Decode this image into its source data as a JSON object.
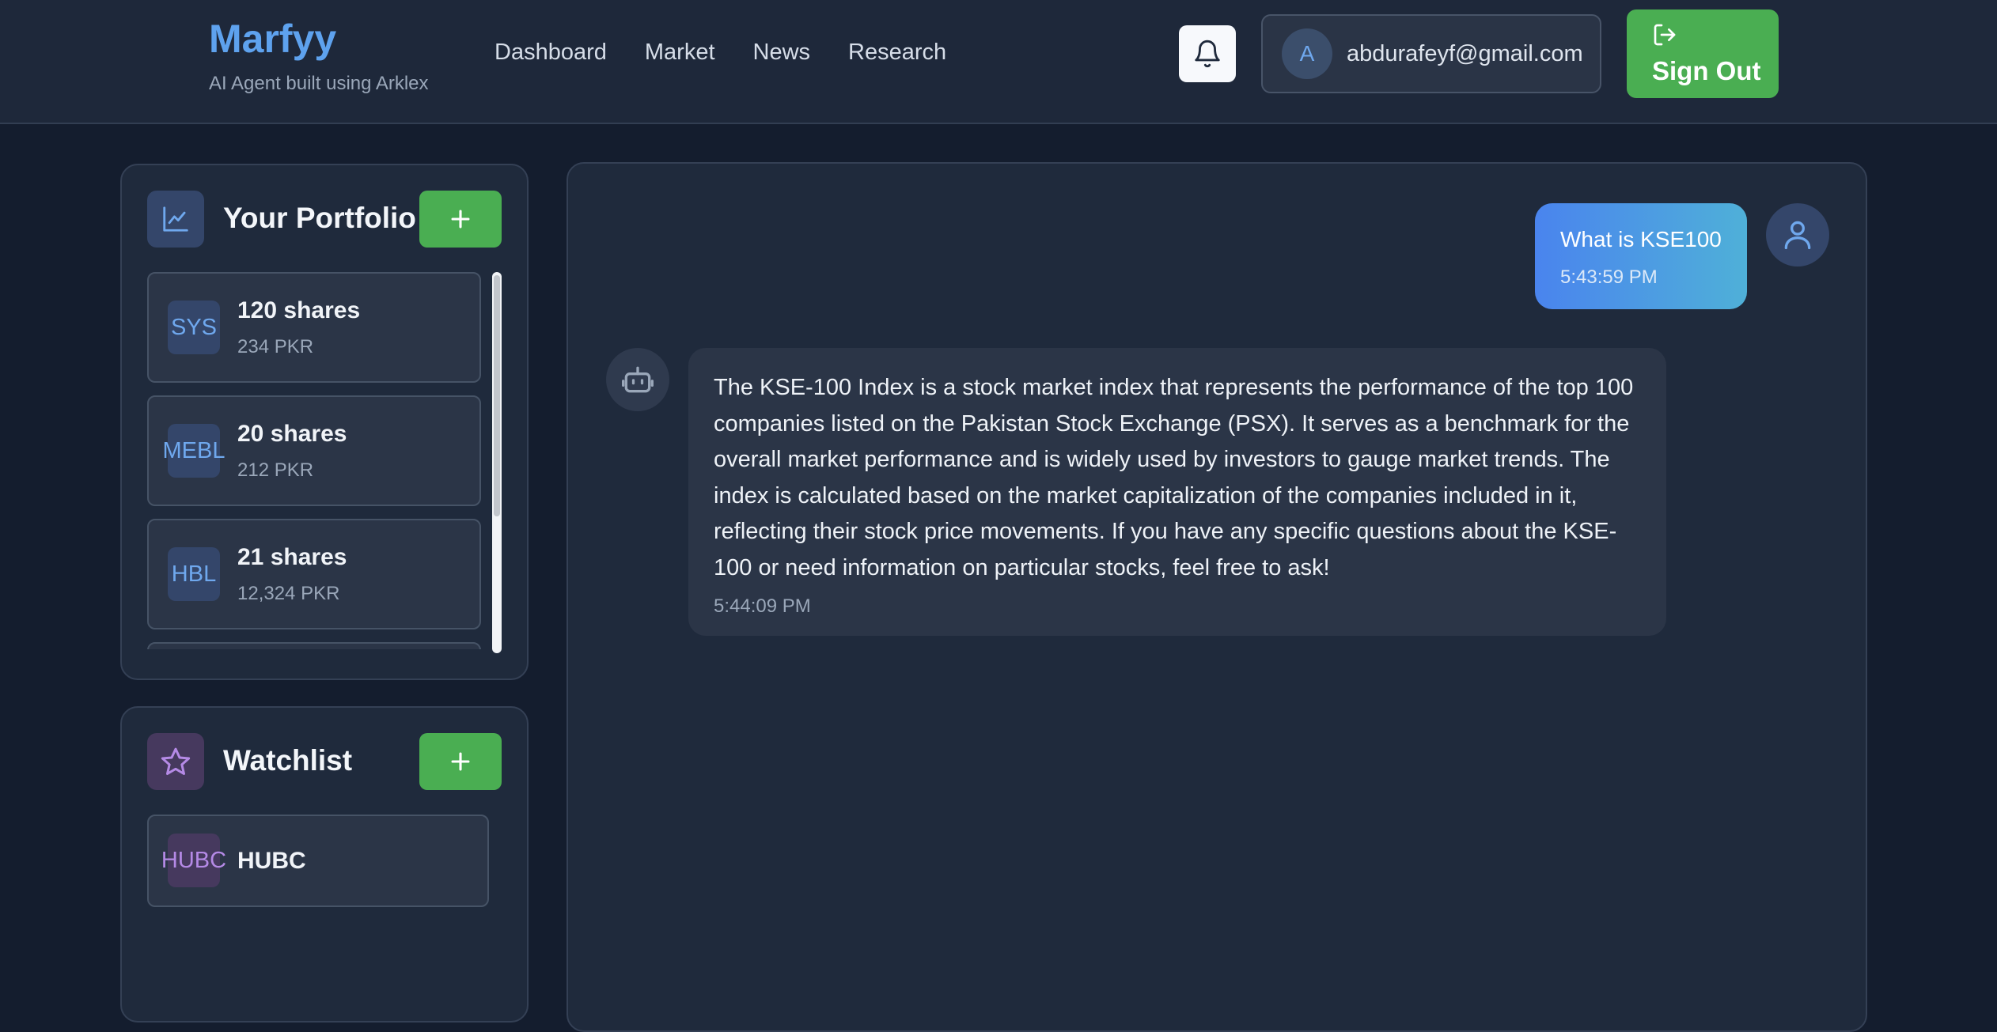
{
  "brand": {
    "title": "Marfyy",
    "subtitle": "AI Agent built using Arklex"
  },
  "nav": {
    "items": [
      "Dashboard",
      "Market",
      "News",
      "Research"
    ]
  },
  "user": {
    "initial": "A",
    "email": "abdurafeyf@gmail.com"
  },
  "header": {
    "signout_label": "Sign Out",
    "bell_icon": "bell-icon",
    "signout_icon": "log-out-icon"
  },
  "portfolio": {
    "title": "Your Portfolio",
    "icon": "chart-line-icon",
    "add_icon": "plus-icon",
    "holdings": [
      {
        "ticker": "SYS",
        "shares": "120 shares",
        "value": "234 PKR"
      },
      {
        "ticker": "MEBL",
        "shares": "20 shares",
        "value": "212 PKR"
      },
      {
        "ticker": "HBL",
        "shares": "21 shares",
        "value": "12,324 PKR"
      }
    ]
  },
  "watchlist": {
    "title": "Watchlist",
    "icon": "star-icon",
    "add_icon": "plus-icon",
    "items": [
      {
        "ticker": "HUBC",
        "name": "HUBC"
      }
    ]
  },
  "chat": {
    "messages": [
      {
        "role": "user",
        "text": "What is KSE100",
        "time": "5:43:59 PM"
      },
      {
        "role": "bot",
        "text": "The KSE-100 Index is a stock market index that represents the performance of the top 100 companies listed on the Pakistan Stock Exchange (PSX). It serves as a benchmark for the overall market performance and is widely used by investors to gauge market trends. The index is calculated based on the market capitalization of the companies included in it, reflecting their stock price movements. If you have any specific questions about the KSE-100 or need information on particular stocks, feel free to ask!",
        "time": "5:44:09 PM"
      }
    ],
    "user_avatar_icon": "user-icon",
    "bot_avatar_icon": "bot-icon"
  },
  "colors": {
    "accent_blue": "#5ea2ee",
    "accent_green": "#4aae52",
    "accent_purple": "#b58ae6",
    "background": "#141d2e"
  }
}
